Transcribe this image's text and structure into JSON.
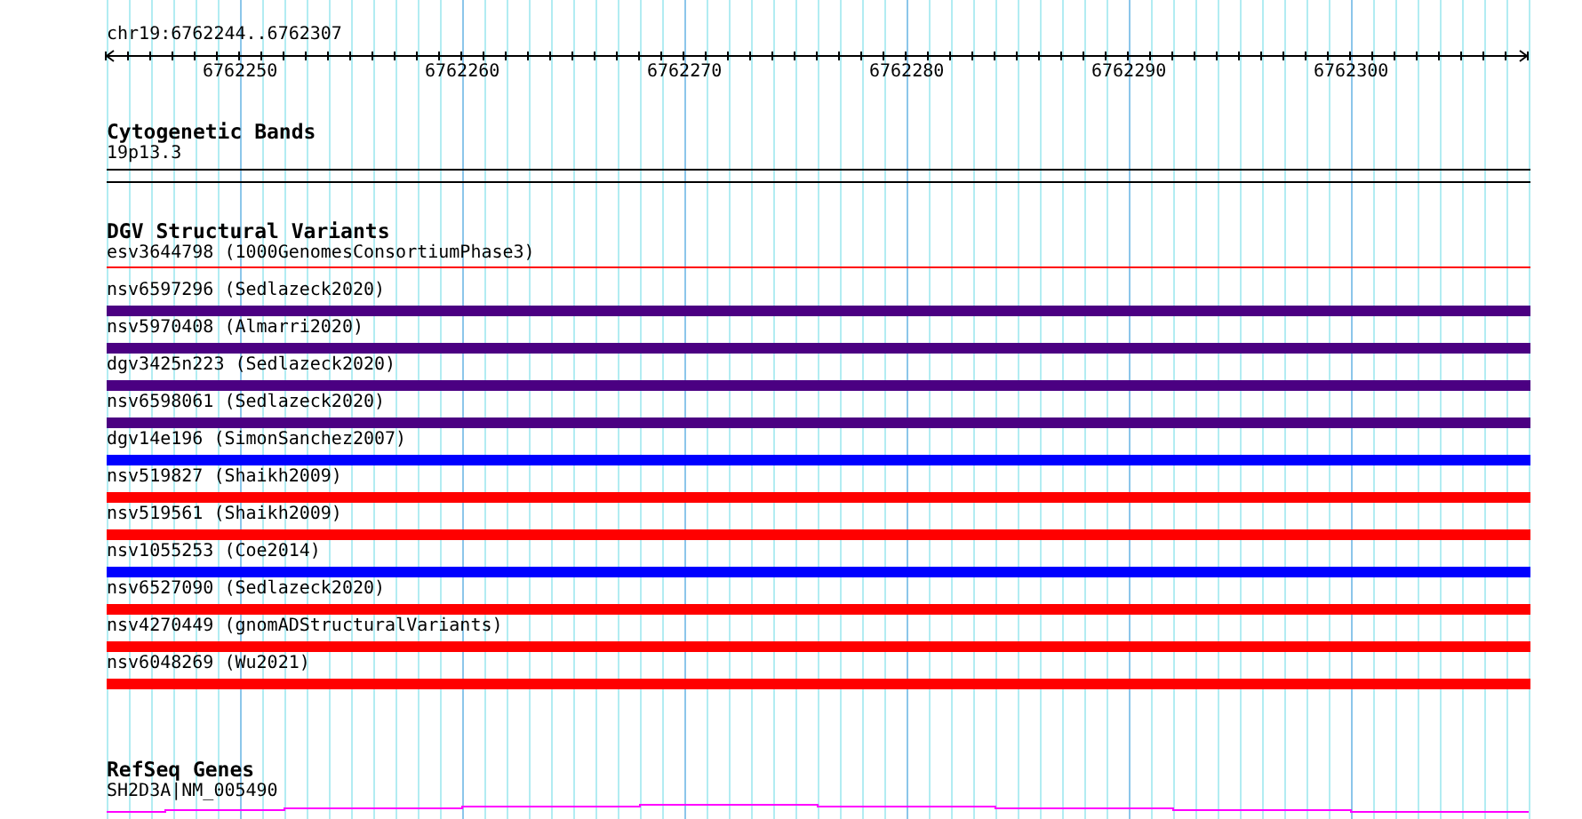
{
  "ruler": {
    "location": "chr19:6762244..6762307",
    "ticks": [
      "6762250",
      "6762260",
      "6762270",
      "6762280",
      "6762290",
      "6762300"
    ]
  },
  "cytogenetic_bands": {
    "title": "Cytogenetic Bands",
    "band": "19p13.3"
  },
  "dgv_structural_variants": {
    "title": "DGV Structural Variants",
    "variants": [
      {
        "label": "esv3644798 (1000GenomesConsortiumPhase3)",
        "kind": "line",
        "color": "#ff0000"
      },
      {
        "label": "nsv6597296 (Sedlazeck2020)",
        "kind": "bar",
        "color": "#4b0082"
      },
      {
        "label": "nsv5970408 (Almarri2020)",
        "kind": "bar",
        "color": "#4b0082"
      },
      {
        "label": "dgv3425n223 (Sedlazeck2020)",
        "kind": "bar",
        "color": "#4b0082"
      },
      {
        "label": "nsv6598061 (Sedlazeck2020)",
        "kind": "bar",
        "color": "#4b0082"
      },
      {
        "label": "dgv14e196 (SimonSanchez2007)",
        "kind": "bar",
        "color": "#0000ff"
      },
      {
        "label": "nsv519827 (Shaikh2009)",
        "kind": "bar",
        "color": "#ff0000"
      },
      {
        "label": "nsv519561 (Shaikh2009)",
        "kind": "bar",
        "color": "#ff0000"
      },
      {
        "label": "nsv1055253 (Coe2014)",
        "kind": "bar",
        "color": "#0000ff"
      },
      {
        "label": "nsv6527090 (Sedlazeck2020)",
        "kind": "bar",
        "color": "#ff0000"
      },
      {
        "label": "nsv4270449 (gnomADStructuralVariants)",
        "kind": "bar",
        "color": "#ff0000"
      },
      {
        "label": "nsv6048269 (Wu2021)",
        "kind": "bar",
        "color": "#ff0000"
      }
    ]
  },
  "refseq_genes": {
    "title": "RefSeq Genes",
    "gene": "SH2D3A|NM_005490"
  }
}
